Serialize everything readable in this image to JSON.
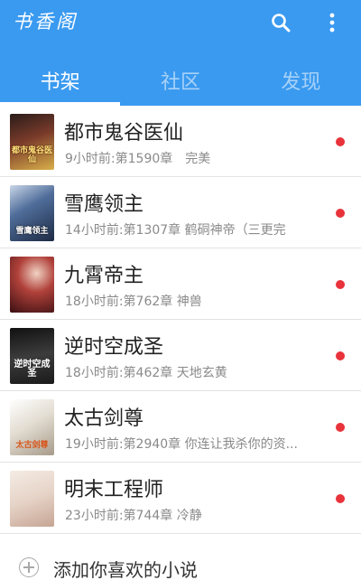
{
  "app": {
    "title": "书香阁"
  },
  "header": {
    "search_icon": "search-icon",
    "more_icon": "more-vert-icon",
    "tabs": [
      {
        "label": "书架",
        "active": true
      },
      {
        "label": "社区",
        "active": false
      },
      {
        "label": "发现",
        "active": false
      }
    ]
  },
  "colors": {
    "primary": "#3a9af0",
    "unread_dot": "#e8333b"
  },
  "books": [
    {
      "title": "都市鬼谷医仙",
      "subtitle": "9小时前:第1590章　完美",
      "cover_text": "都市鬼谷医仙",
      "unread": true
    },
    {
      "title": "雪鹰领主",
      "subtitle": "14小时前:第1307章 鹤硐神帝（三更完",
      "cover_text": "雪鹰领主",
      "unread": true
    },
    {
      "title": "九霄帝主",
      "subtitle": "18小时前:第762章 神兽",
      "cover_text": "",
      "unread": true
    },
    {
      "title": "逆时空成圣",
      "subtitle": "18小时前:第462章 天地玄黄",
      "cover_text": "逆时空成圣",
      "unread": true
    },
    {
      "title": "太古剑尊",
      "subtitle": "19小时前:第2940章 你连让我杀你的资...",
      "cover_text": "太古剑尊",
      "unread": true
    },
    {
      "title": "明末工程师",
      "subtitle": "23小时前:第744章 冷静",
      "cover_text": "",
      "unread": true
    }
  ],
  "add_book": {
    "label": "添加你喜欢的小说"
  }
}
